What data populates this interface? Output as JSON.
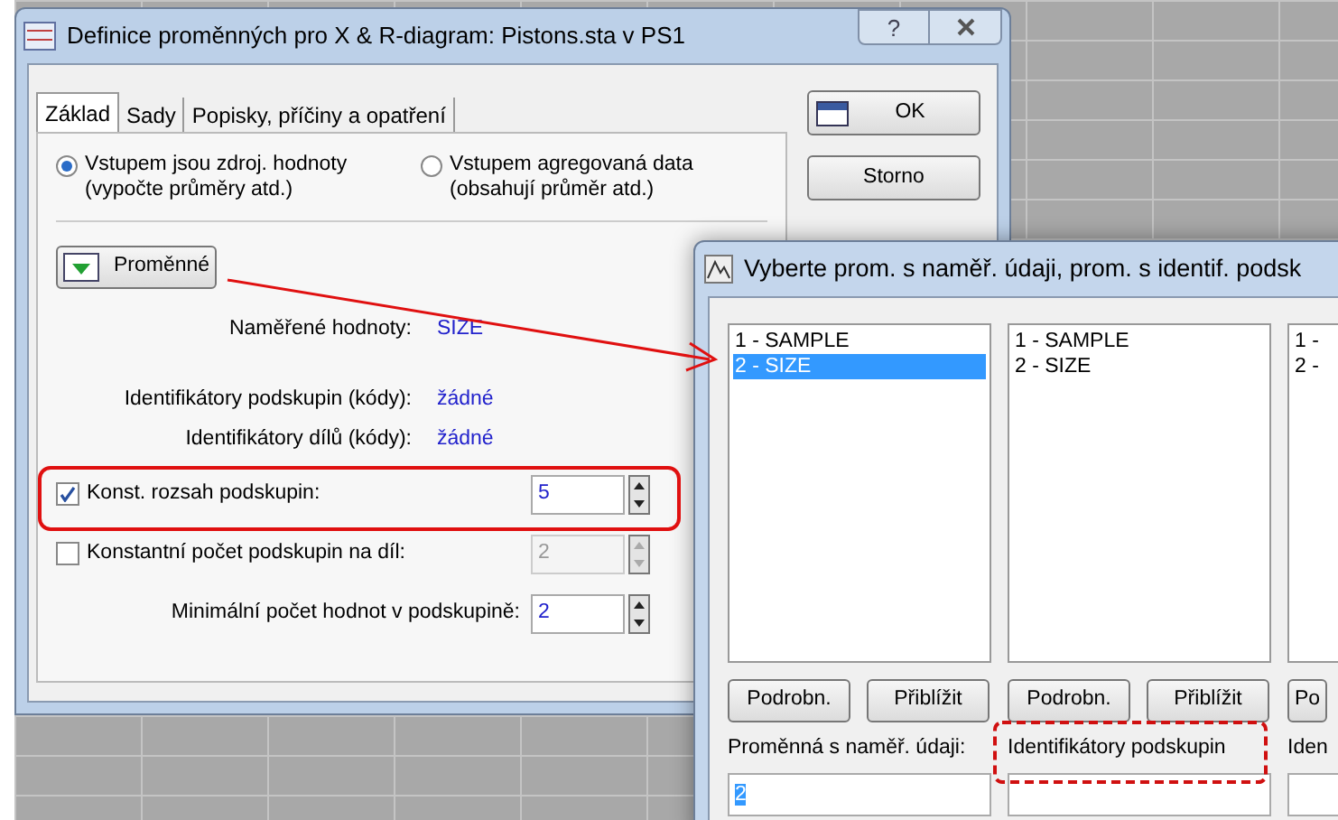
{
  "main_window": {
    "title": "Definice proměnných pro X & R-diagram: Pistons.sta v PS1",
    "title_buttons": [
      "?"
    ],
    "tabs": [
      {
        "label": "Základ",
        "selected": true
      },
      {
        "label": "Sady",
        "selected": false
      },
      {
        "label": "Popisky, příčiny a opatření",
        "selected": false
      }
    ],
    "radios": [
      {
        "label": "Vstupem jsou zdroj. hodnoty",
        "note": "(vypočte průměry atd.)",
        "selected": true
      },
      {
        "label": "Vstupem agregovaná data",
        "note": "(obsahují průměr atd.)",
        "selected": false
      }
    ],
    "variables_button": "Proměnné",
    "assignments": [
      {
        "label": "Naměřené hodnoty:",
        "value": "SIZE"
      },
      {
        "label": "Identifikátory podskupin (kódy):",
        "value": "žádné"
      },
      {
        "label": "Identifikátory dílů (kódy):",
        "value": "žádné"
      }
    ],
    "options": [
      {
        "kind": "checkbox",
        "label": "Konst. rozsah podskupin:",
        "checked": true,
        "value": "5",
        "disabled": false
      },
      {
        "kind": "checkbox",
        "label": "Konstantní počet podskupin na díl:",
        "checked": false,
        "value": "2",
        "disabled": true
      },
      {
        "kind": "spin",
        "label": "Minimální počet hodnot v podskupině:",
        "value": "2",
        "disabled": false
      }
    ],
    "buttons": [
      "OK",
      "Storno"
    ]
  },
  "select_dialog": {
    "title": "Vyberte prom. s naměř. údaji, prom. s identif. podsk",
    "columns": [
      {
        "items": [
          {
            "text": "1 - SAMPLE",
            "selected": false
          },
          {
            "text": "2 - SIZE",
            "selected": true
          }
        ],
        "buttons": [
          "Podrobn.",
          "Přiblížit"
        ],
        "label": "Proměnná s naměř. údaji:",
        "value": "2",
        "value_selected": true
      },
      {
        "items": [
          {
            "text": "1 - SAMPLE",
            "selected": false
          },
          {
            "text": "2 - SIZE",
            "selected": false
          }
        ],
        "buttons": [
          "Podrobn.",
          "Přiblížit"
        ],
        "label": "Identifikátory podskupin"
      },
      {
        "items": [
          {
            "text": "1 -",
            "selected": false
          },
          {
            "text": "2 -",
            "selected": false
          }
        ],
        "buttons": [
          "Po"
        ],
        "label": "Iden"
      }
    ]
  }
}
